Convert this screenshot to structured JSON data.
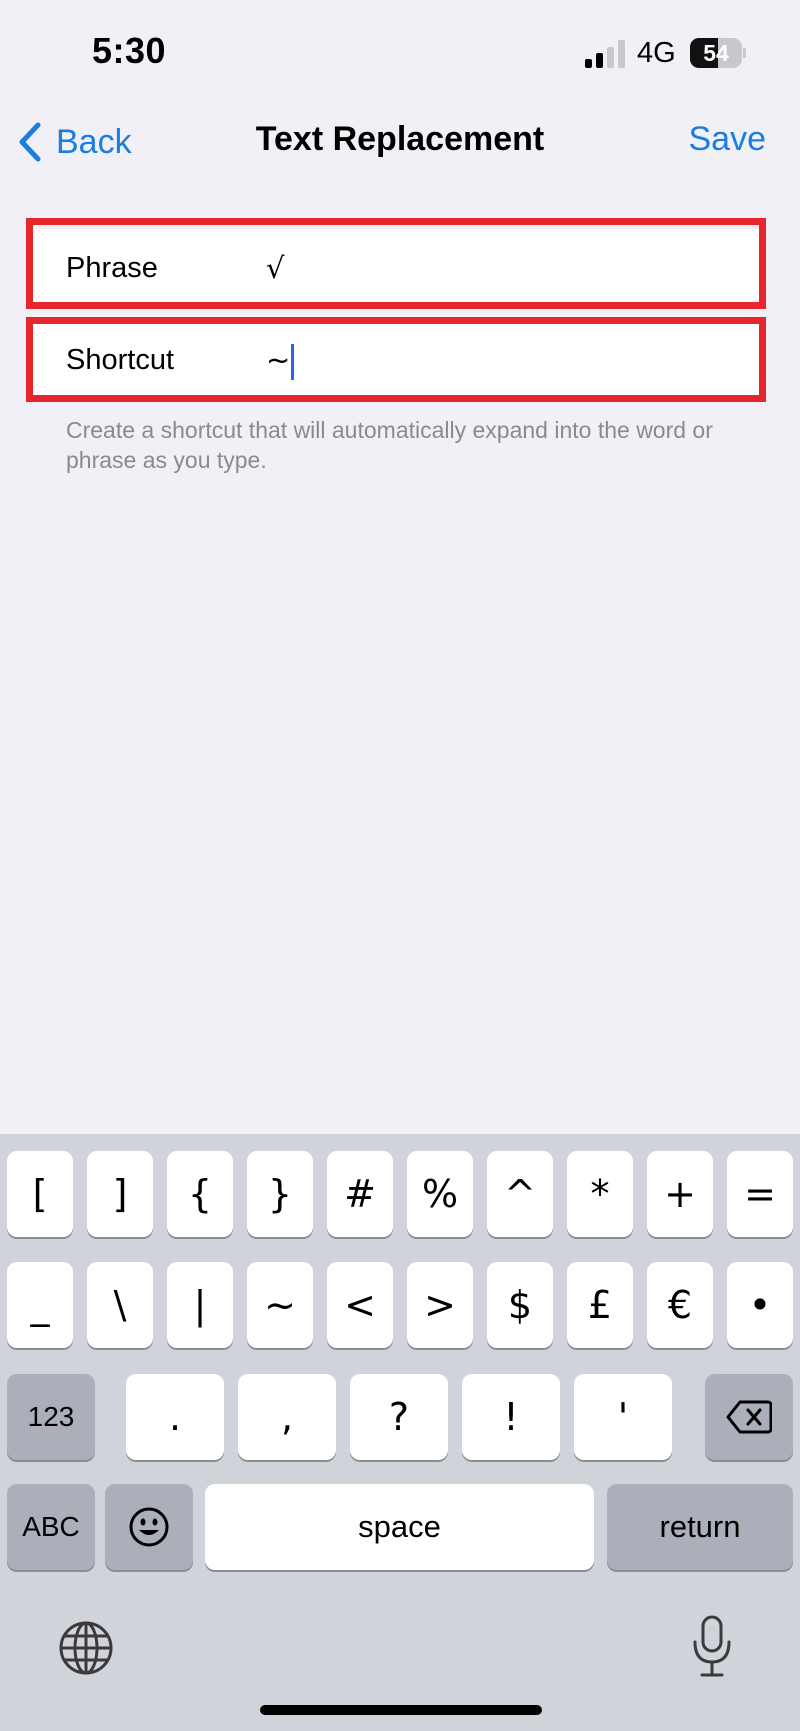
{
  "status_bar": {
    "time": "5:30",
    "network": "4G",
    "battery_percent": "54",
    "battery_level": 0.54,
    "signal_bars_active": 2
  },
  "nav": {
    "back_label": "Back",
    "title": "Text Replacement",
    "save_label": "Save",
    "accent_color": "#1a7ee0"
  },
  "form": {
    "phrase_label": "Phrase",
    "phrase_value": "√",
    "shortcut_label": "Shortcut",
    "shortcut_value": "~",
    "footnote": "Create a shortcut that will automatically expand into the word or phrase as you type.",
    "highlight_color": "#e6252c"
  },
  "keyboard": {
    "row1": [
      "[",
      "]",
      "{",
      "}",
      "#",
      "%",
      "^",
      "*",
      "+",
      "="
    ],
    "row2": [
      "_",
      "\\",
      "|",
      "~",
      "<",
      ">",
      "$",
      "£",
      "€",
      "•"
    ],
    "row3_left": "123",
    "row3": [
      ".",
      ",",
      "?",
      "!",
      "'"
    ],
    "row3_right_icon": "delete-backward-icon",
    "abc_label": "ABC",
    "emoji_icon": "emoji-icon",
    "space_label": "space",
    "return_label": "return",
    "globe_icon": "globe-icon",
    "mic_icon": "microphone-icon"
  }
}
